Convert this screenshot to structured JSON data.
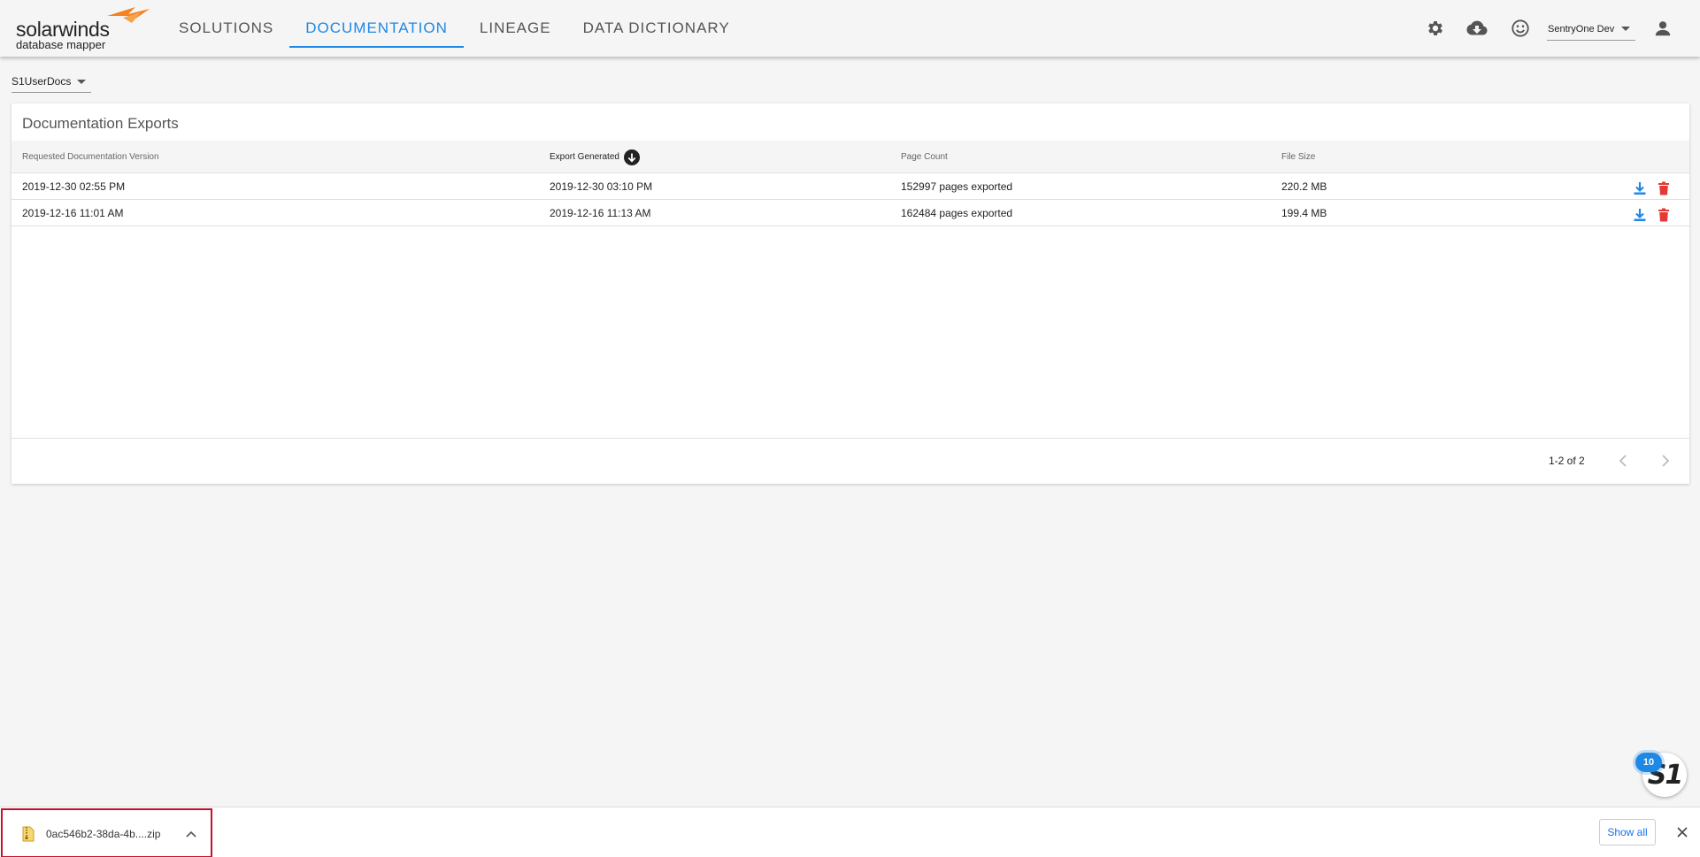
{
  "header": {
    "logo": {
      "brand": "solarwinds",
      "product": "database mapper"
    },
    "nav": [
      {
        "label": "SOLUTIONS",
        "active": false
      },
      {
        "label": "DOCUMENTATION",
        "active": true
      },
      {
        "label": "LINEAGE",
        "active": false
      },
      {
        "label": "DATA DICTIONARY",
        "active": false
      }
    ],
    "icons": [
      "gear-icon",
      "cloud-download-icon",
      "smiley-icon",
      "person-icon"
    ],
    "user_select": "SentryOne Dev"
  },
  "doc_select": "S1UserDocs",
  "exports": {
    "title": "Documentation Exports",
    "columns": [
      "Requested Documentation Version",
      "Export Generated",
      "Page Count",
      "File Size"
    ],
    "sorted_column": "Export Generated",
    "rows": [
      {
        "requested": "2019-12-30 02:55 PM",
        "generated": "2019-12-30 03:10 PM",
        "pages": "152997 pages exported",
        "size": "220.2 MB"
      },
      {
        "requested": "2019-12-16 11:01 AM",
        "generated": "2019-12-16 11:13 AM",
        "pages": "162484 pages exported",
        "size": "199.4 MB"
      }
    ],
    "pagination": "1-2 of 2"
  },
  "s1_badge": {
    "text": "S1",
    "count": "10"
  },
  "download_bar": {
    "file_name": "0ac546b2-38da-4b....zip",
    "show_all": "Show all"
  },
  "colors": {
    "accent": "#1e88e5",
    "logo_orange": "#f58220",
    "delete_red": "#e53935",
    "highlight_border": "#c8102e"
  }
}
